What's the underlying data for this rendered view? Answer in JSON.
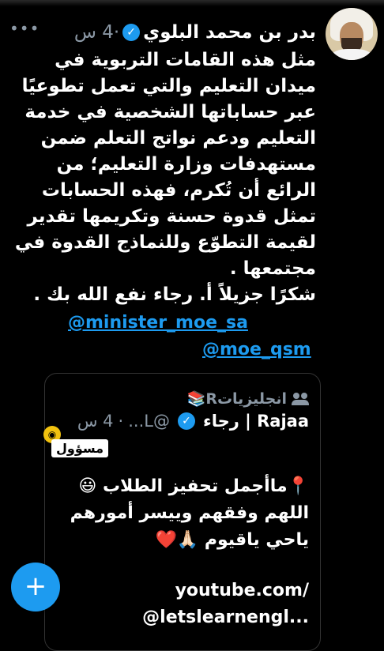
{
  "tweet": {
    "author_name": "بدر بن محمد البلوي",
    "time": "4 س",
    "more_menu": "•••",
    "body_lines": [
      "مثل هذه القامات التربوية في",
      "ميدان التعليم والتي تعمل تطوعيًا",
      "عبر حساباتها الشخصية في خدمة",
      "التعليم ودعم نواتج التعلم ضمن",
      "مستهدفات وزارة التعليم؛ من",
      "الرائع أن تُكرم، فهذه الحسابات",
      "تمثل قدوة حسنة وتكريمها تقدير",
      "لقيمة التطوّع وللنماذج القدوة في",
      "مجتمعها .",
      "شكرًا جزيلاً أ. رجاء نفع الله بك ."
    ],
    "mentions": [
      "@minister_moe_sa",
      "@moe_qsm"
    ]
  },
  "quoted": {
    "community": "انجليزياتR📚",
    "author_name": "Rajaa | رجاء",
    "handle": "@L...",
    "time": "4 س",
    "badge": "مسؤول",
    "body_lines": [
      "📍ماأجمل تحفيز الطلاب 😃",
      "اللهم وفقهم وييسر أمورهم",
      "ياحي ياقيوم 🙏🏻❤️"
    ],
    "link_lines": [
      "youtube.com/",
      "@letslearnengl..."
    ]
  },
  "fab": {
    "label": "+"
  },
  "colors": {
    "accent": "#1d9bf0",
    "muted": "#8b98a5",
    "background": "#000000"
  }
}
